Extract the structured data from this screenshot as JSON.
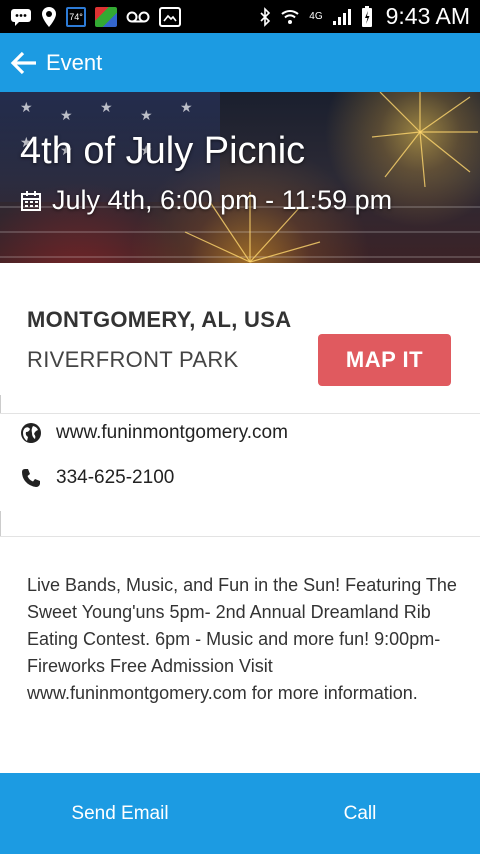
{
  "status_bar": {
    "time": "9:43 AM",
    "temperature": "74°",
    "network": "4G",
    "icons": [
      "messages-icon",
      "location-pin-icon",
      "weather-icon",
      "photos-icon",
      "voicemail-icon",
      "gallery-icon",
      "bluetooth-icon",
      "wifi-icon",
      "signal-icon",
      "battery-icon"
    ]
  },
  "app_bar": {
    "back_icon": "arrow-left-icon",
    "title": "Event"
  },
  "event": {
    "title": "4th of July Picnic",
    "date_icon": "calendar-icon",
    "date_time": "July 4th, 6:00 pm - 11:59 pm"
  },
  "location": {
    "city": "MONTGOMERY, AL, USA",
    "venue": "RIVERFRONT PARK",
    "map_button": "MAP IT"
  },
  "contact": {
    "website_icon": "globe-icon",
    "website": "www.funinmontgomery.com",
    "phone_icon": "phone-icon",
    "phone": "334-625-2100"
  },
  "description": "Live Bands, Music, and Fun in the Sun! Featuring The Sweet Young'uns 5pm- 2nd Annual Dreamland Rib Eating Contest. 6pm - Music and more fun! 9:00pm- Fireworks Free Admission Visit www.funinmontgomery.com for more information.",
  "actions": {
    "send_email": "Send Email",
    "call": "Call"
  },
  "colors": {
    "primary": "#1c9be2",
    "map_button": "#e05a5f",
    "status_bar": "#000000"
  }
}
